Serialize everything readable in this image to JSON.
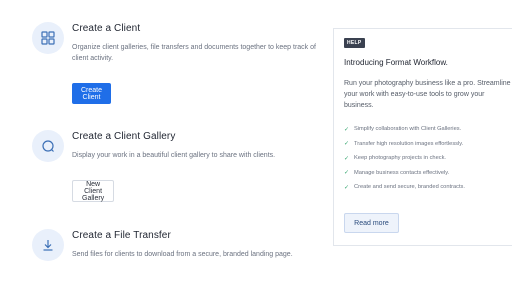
{
  "sections": [
    {
      "title": "Create a Client",
      "description": "Organize client galleries, file transfers and documents together to keep track of client activity.",
      "icon": "client-grid-icon",
      "button_label": "Create Client"
    },
    {
      "title": "Create a Client Gallery",
      "description": "Display your work in a beautiful client gallery to share with clients.",
      "icon": "gallery-icon",
      "button_label": "New Client Gallery"
    },
    {
      "title": "Create a File Transfer",
      "description": "Send files for clients to download from a secure, branded landing page.",
      "icon": "download-arrow-icon"
    }
  ],
  "help_panel": {
    "badge": "HELP",
    "title": "Introducing Format Workflow.",
    "description": "Run your photography business like a pro. Streamline your work with easy-to-use tools to grow your business.",
    "features": [
      "Simplify collaboration with Client Galleries.",
      "Transfer high resolution images effortlessly.",
      "Keep photography projects in check.",
      "Manage business contacts effectively.",
      "Create and send secure, branded contracts."
    ],
    "button_label": "Read more"
  },
  "colors": {
    "primary": "#1f6ee8",
    "icon_bg": "#e9f0fb",
    "check": "#2fa36b"
  }
}
